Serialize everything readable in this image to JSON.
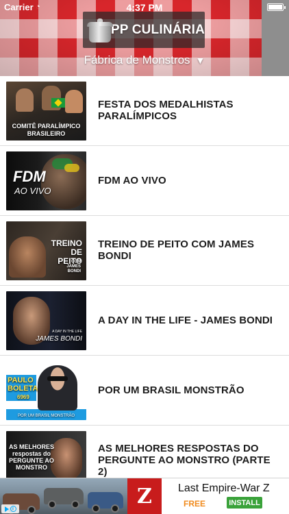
{
  "status_bar": {
    "carrier": "Carrier",
    "time": "4:37 PM"
  },
  "header": {
    "app_title": "APP CULINÁRIA",
    "channel": "Fábrica de Monstros",
    "colors": {
      "check_red": "#d8262b",
      "side_panel": "#8e8e8e"
    },
    "icons": {
      "logo": "pot-icon",
      "dropdown": "triangle-down-icon"
    }
  },
  "videos": [
    {
      "title": "FESTA DOS MEDALHISTAS PARALÍMPICOS",
      "thumb_text": [
        "COMITÊ PARALÍMPICO",
        "BRASILEIRO"
      ]
    },
    {
      "title": "FDM AO VIVO",
      "thumb_text": [
        "FDM",
        "AO VIVO"
      ]
    },
    {
      "title": "TREINO DE PEITO COM JAMES BONDI",
      "thumb_text": [
        "TREINO DE PEITO",
        "COM JAMES BONDI"
      ]
    },
    {
      "title": "A DAY IN THE LIFE - JAMES BONDI",
      "thumb_text": [
        "A DAY IN THE LIFE",
        "JAMES BONDI"
      ]
    },
    {
      "title": "POR UM BRASIL MONSTRÃO",
      "thumb_text": [
        "PAULO BOLETA",
        "6969",
        "POR UM BRASIL MONSTRÃO"
      ]
    },
    {
      "title": "AS MELHORES RESPOSTAS DO PERGUNTE AO MONSTRO (PARTE 2)",
      "thumb_text": [
        "AS MELHORES respostas do PERGUNTE AO MONSTRO"
      ]
    }
  ],
  "ad": {
    "title": "Last Empire-War Z",
    "price": "FREE",
    "install_label": "INSTALL",
    "app_icon_letter": "Z",
    "colors": {
      "free": "#f08a1c",
      "install": "#3aa23a",
      "icon_bg": "#c81c1c"
    }
  }
}
